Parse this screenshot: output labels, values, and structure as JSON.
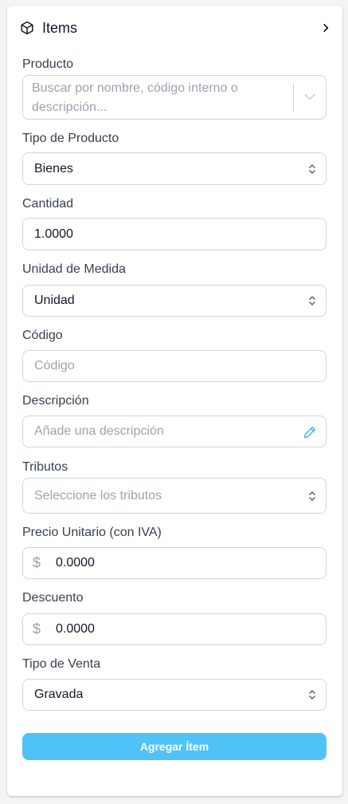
{
  "header": {
    "title": "Items",
    "icon": "cube-icon"
  },
  "fields": {
    "producto": {
      "label": "Producto",
      "placeholder": "Buscar por nombre, código interno o descripción..."
    },
    "tipo_producto": {
      "label": "Tipo de Producto",
      "value": "Bienes"
    },
    "cantidad": {
      "label": "Cantidad",
      "value": "1.0000"
    },
    "unidad_medida": {
      "label": "Unidad de Medida",
      "value": "Unidad"
    },
    "codigo": {
      "label": "Código",
      "placeholder": "Código"
    },
    "descripcion": {
      "label": "Descripción",
      "placeholder": "Añade una descripción"
    },
    "tributos": {
      "label": "Tributos",
      "placeholder": "Seleccione los tributos"
    },
    "precio_unitario": {
      "label": "Precio Unitario (con IVA)",
      "prefix": "$",
      "value": "0.0000"
    },
    "descuento": {
      "label": "Descuento",
      "prefix": "$",
      "value": "0.0000"
    },
    "tipo_venta": {
      "label": "Tipo de Venta",
      "value": "Gravada"
    }
  },
  "submit": {
    "label": "Agregar Ítem"
  },
  "colors": {
    "accent": "#4fc3f7",
    "edit_icon": "#38bdf8",
    "border": "#d1d5db"
  }
}
